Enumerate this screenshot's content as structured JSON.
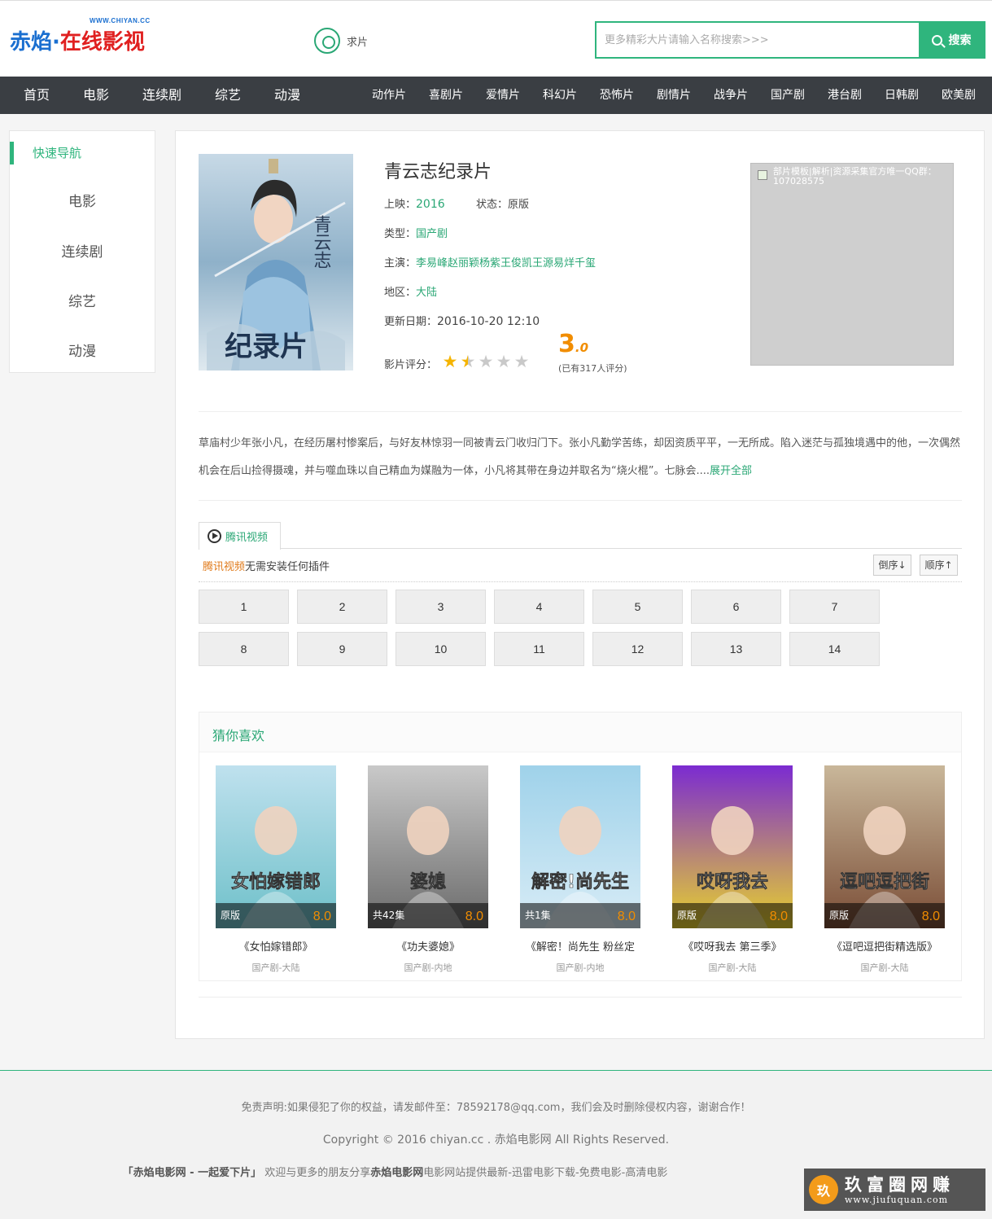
{
  "header": {
    "logo_url": "WWW.CHIYAN.CC",
    "logo_part1": "赤焰·",
    "logo_part2": "在线影视",
    "request_label": "求片",
    "search_placeholder": "更多精彩大片请输入名称搜索>>>",
    "search_button": "搜索"
  },
  "nav": {
    "main": [
      "首页",
      "电影",
      "连续剧",
      "综艺",
      "动漫"
    ],
    "genres": [
      "动作片",
      "喜剧片",
      "爱情片",
      "科幻片",
      "恐怖片",
      "剧情片",
      "战争片",
      "国产剧",
      "港台剧",
      "日韩剧",
      "欧美剧"
    ]
  },
  "sidebar": {
    "title": "快速导航",
    "items": [
      "电影",
      "连续剧",
      "综艺",
      "动漫"
    ]
  },
  "detail": {
    "poster_text": "纪录片",
    "poster_title_art": "青云志",
    "title": "青云志纪录片",
    "release_label": "上映：",
    "release": "2016",
    "status_label": "状态：",
    "status": "原版",
    "type_label": "类型：",
    "type": "国产剧",
    "cast_label": "主演：",
    "cast": "李易峰赵丽颖杨紫王俊凯王源易烊千玺",
    "region_label": "地区：",
    "region": "大陆",
    "update_label": "更新日期：",
    "update": "2016-10-20 12:10",
    "rating_label": "影片评分：",
    "rating": 3.0,
    "score_int": "3",
    "score_dec": ".0",
    "stars_filled": 1.5,
    "stars_total": 5,
    "rating_count": "(已有317人评分)",
    "ad_text": "部片模板|解析|资源采集官方唯一QQ群：107028575"
  },
  "description": {
    "text": "草庙村少年张小凡，在经历屠村惨案后，与好友林惊羽一同被青云门收归门下。张小凡勤学苦练，却因资质平平，一无所成。陷入迷茫与孤独境遇中的他，一次偶然机会在后山捡得摄魂，并与噬血珠以自己精血为媒融为一体，小凡将其带在身边并取名为“烧火棍”。七脉会....",
    "more": "展开全部"
  },
  "player": {
    "tab_label": "腾讯视频",
    "note_source": "腾讯视频",
    "note_rest": "无需安装任何插件",
    "sort_desc": "倒序↓",
    "sort_asc": "顺序↑",
    "episodes": [
      "1",
      "2",
      "3",
      "4",
      "5",
      "6",
      "7",
      "8",
      "9",
      "10",
      "11",
      "12",
      "13",
      "14"
    ]
  },
  "recommend": {
    "title": "猜你喜欢",
    "items": [
      {
        "name": "《女怕嫁错郎》",
        "status": "原版",
        "score": "8.0",
        "meta": "国产剧-大陆",
        "art": "女怕嫁错郎",
        "colors": [
          "#bfe1ee",
          "#6ec0c9"
        ]
      },
      {
        "name": "《功夫婆媳》",
        "status": "共42集",
        "score": "8.0",
        "meta": "国产剧-内地",
        "art": "婆媳",
        "colors": [
          "#c9c9c9",
          "#6a6a6a"
        ]
      },
      {
        "name": "《解密！尚先生 粉丝定",
        "status": "共1集",
        "score": "8.0",
        "meta": "国产剧-内地",
        "art": "解密!尚先生",
        "colors": [
          "#9fd2ea",
          "#d8ecf6"
        ]
      },
      {
        "name": "《哎呀我去 第三季》",
        "status": "原版",
        "score": "8.0",
        "meta": "国产剧-大陆",
        "art": "哎呀我去",
        "colors": [
          "#7b2bd1",
          "#e8d22c"
        ]
      },
      {
        "name": "《逗吧逗把街精选版》",
        "status": "原版",
        "score": "8.0",
        "meta": "国产剧-大陆",
        "art": "逗吧逗把街",
        "colors": [
          "#c9b79a",
          "#7a4d36"
        ]
      }
    ]
  },
  "footer": {
    "disclaimer": "免责声明:如果侵犯了你的权益，请发邮件至：78592178@qq.com，我们会及时删除侵权内容，谢谢合作！",
    "copyright": "Copyright © 2016 chiyan.cc . 赤焰电影网 All Rights Reserved.",
    "brand_left": "「赤焰电影网 - 一起爱下片」",
    "slogan_a": " 欢迎与更多的朋友分享",
    "slogan_brand": "赤焰电影网",
    "slogan_b": "电影网站提供最新-迅雷电影下载-免费电影-高清电影"
  },
  "watermark": {
    "text": "玖富圈网赚",
    "url": "www.jiufuquan.com",
    "emblem": "玖"
  },
  "colors": {
    "accent": "#2fb57d",
    "nav_bg": "#3a3e43",
    "score": "#f18d00"
  }
}
